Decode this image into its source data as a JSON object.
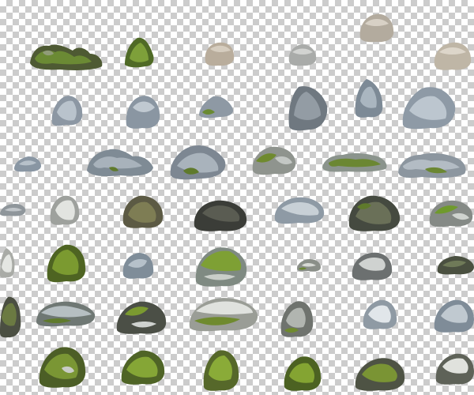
{
  "background": "transparency-checkerboard",
  "palette": {
    "moss": "#5f7a2c",
    "moss_dark": "#3f5420",
    "stone_grey": "#8f9498",
    "stone_blue": "#9aa6b2",
    "stone_dark": "#3a3d3a",
    "stone_beige": "#bfb6a6"
  },
  "rocks": [
    {
      "type": "mossy-cluster"
    },
    {
      "type": "mossy-stone"
    },
    {
      "type": "beige-stone"
    },
    {
      "type": "grey-stone"
    },
    {
      "type": "beige-stone"
    },
    {
      "type": "beige-stone"
    },
    {
      "type": "blue-grey-stone"
    },
    {
      "type": "blue-grey-stone"
    },
    {
      "type": "mossy-blue-stone"
    },
    {
      "type": "dark-blue-stone"
    },
    {
      "type": "blue-grey-stone"
    },
    {
      "type": "blue-grey-stone"
    },
    {
      "type": "blue-grey-stone"
    },
    {
      "type": "flat-blue-cluster"
    },
    {
      "type": "mossy-blue-stone"
    },
    {
      "type": "mossy-grey-stone"
    },
    {
      "type": "flat-mossy-slab"
    },
    {
      "type": "flat-mossy-slab"
    },
    {
      "type": "grey-stone"
    },
    {
      "type": "white-grey-stone"
    },
    {
      "type": "mossy-dark-stone"
    },
    {
      "type": "dark-stone"
    },
    {
      "type": "blue-grey-stone"
    },
    {
      "type": "dark-mossy-stone"
    },
    {
      "type": "mossy-grey-stone"
    },
    {
      "type": "white-stone"
    },
    {
      "type": "moss-covered-stone"
    },
    {
      "type": "blue-grey-stone"
    },
    {
      "type": "moss-covered-stone"
    },
    {
      "type": "small-grey-stone"
    },
    {
      "type": "grey-stone"
    },
    {
      "type": "dark-mossy-stone"
    },
    {
      "type": "mossy-dark-stone"
    },
    {
      "type": "mossy-flat-stone"
    },
    {
      "type": "mossy-dark-stone"
    },
    {
      "type": "moss-covered-stone"
    },
    {
      "type": "mossy-grey-stone"
    },
    {
      "type": "white-blue-stone"
    },
    {
      "type": "blue-grey-stone"
    },
    {
      "type": "moss-covered-stone"
    },
    {
      "type": "moss-covered-stone"
    },
    {
      "type": "moss-covered-stone"
    },
    {
      "type": "moss-covered-stone"
    },
    {
      "type": "mossy-dark-stone"
    },
    {
      "type": "white-grey-stone"
    }
  ]
}
